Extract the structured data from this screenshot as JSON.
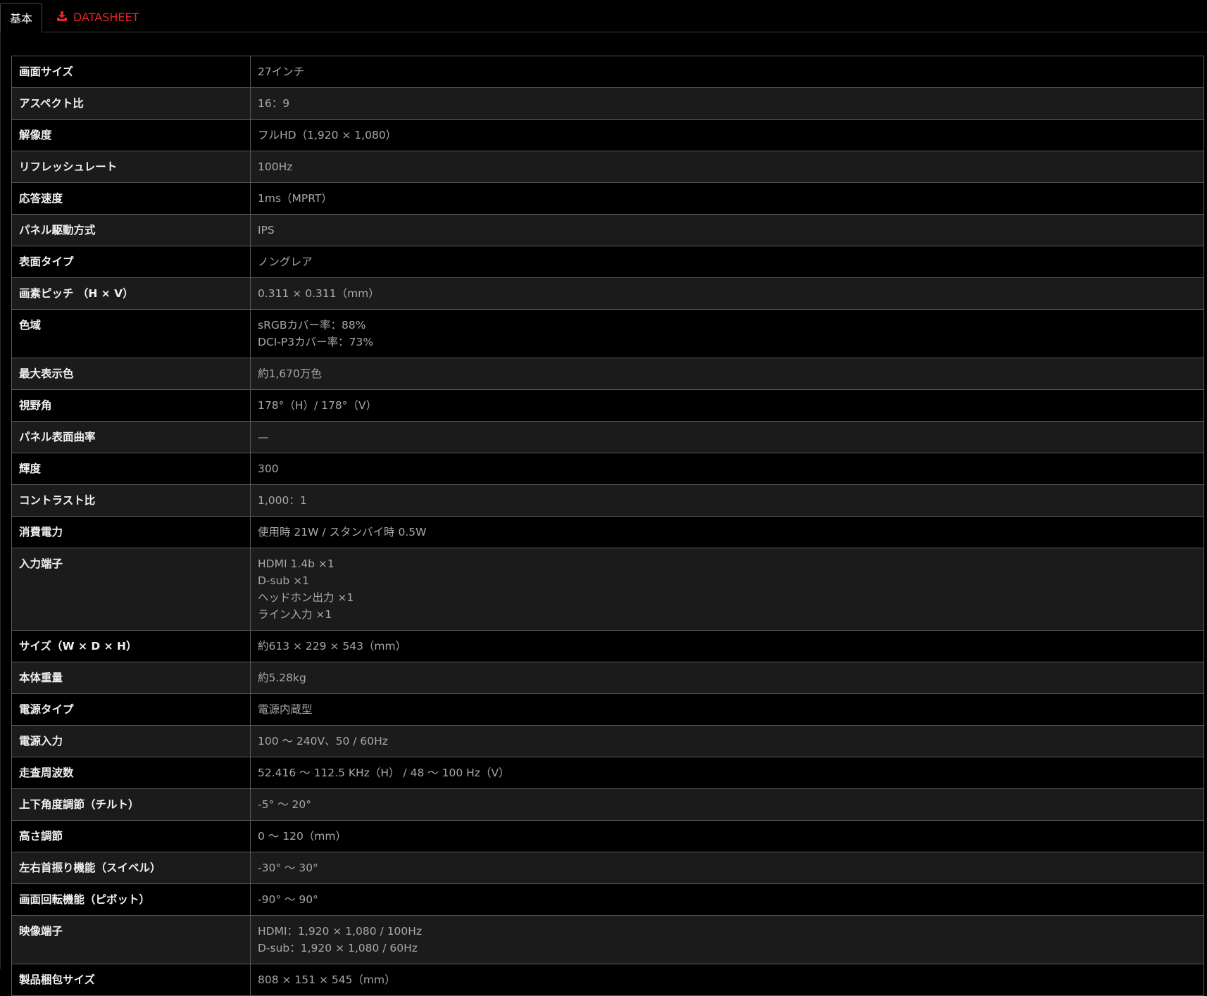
{
  "tabs": {
    "basic": "基本",
    "datasheet": "DATASHEET",
    "datasheet_icon": "download-icon",
    "accent": "#e0262b"
  },
  "specs": [
    {
      "label": "画面サイズ",
      "values": [
        "27インチ"
      ]
    },
    {
      "label": "アスペクト比",
      "values": [
        "16：9"
      ]
    },
    {
      "label": "解像度",
      "values": [
        "フルHD（1,920 × 1,080）"
      ]
    },
    {
      "label": "リフレッシュレート",
      "values": [
        "100Hz"
      ]
    },
    {
      "label": "応答速度",
      "values": [
        "1ms（MPRT）"
      ]
    },
    {
      "label": "パネル駆動方式",
      "values": [
        "IPS"
      ]
    },
    {
      "label": "表面タイプ",
      "values": [
        "ノングレア"
      ]
    },
    {
      "label": "画素ピッチ （H × V）",
      "values": [
        "0.311 × 0.311（mm）"
      ]
    },
    {
      "label": "色域",
      "values": [
        "sRGBカバー率：88%",
        "DCI-P3カバー率：73%"
      ]
    },
    {
      "label": "最大表示色",
      "values": [
        "約1,670万色"
      ]
    },
    {
      "label": "視野角",
      "values": [
        "178°（H）/ 178°（V）"
      ]
    },
    {
      "label": "パネル表面曲率",
      "values": [
        "—"
      ]
    },
    {
      "label": "輝度",
      "values": [
        "300"
      ]
    },
    {
      "label": "コントラスト比",
      "values": [
        "1,000：1"
      ]
    },
    {
      "label": "消費電力",
      "values": [
        "使用時 21W / スタンバイ時 0.5W"
      ]
    },
    {
      "label": "入力端子",
      "values": [
        "HDMI 1.4b ×1",
        "D-sub ×1",
        "ヘッドホン出力 ×1",
        "ライン入力 ×1"
      ]
    },
    {
      "label": "サイズ（W × D × H）",
      "values": [
        "約613 × 229 × 543（mm）"
      ]
    },
    {
      "label": "本体重量",
      "values": [
        "約5.28kg"
      ]
    },
    {
      "label": "電源タイプ",
      "values": [
        "電源内蔵型"
      ]
    },
    {
      "label": "電源入力",
      "values": [
        "100 ～ 240V、50 / 60Hz"
      ]
    },
    {
      "label": "走査周波数",
      "values": [
        "52.416 ～ 112.5 KHz（H） / 48 ～ 100 Hz（V）"
      ]
    },
    {
      "label": "上下角度調節（チルト）",
      "values": [
        "-5° ～ 20°"
      ]
    },
    {
      "label": "高さ調節",
      "values": [
        "0 ～ 120（mm）"
      ]
    },
    {
      "label": "左右首振り機能（スイベル）",
      "values": [
        "-30° ～ 30°"
      ]
    },
    {
      "label": "画面回転機能（ピボット）",
      "values": [
        "-90° ～ 90°"
      ]
    },
    {
      "label": "映像端子",
      "values": [
        "HDMI：1,920 × 1,080 / 100Hz",
        "D-sub：1,920 × 1,080 / 60Hz"
      ]
    },
    {
      "label": "製品梱包サイズ",
      "values": [
        "808 × 151 × 545（mm）"
      ]
    }
  ]
}
